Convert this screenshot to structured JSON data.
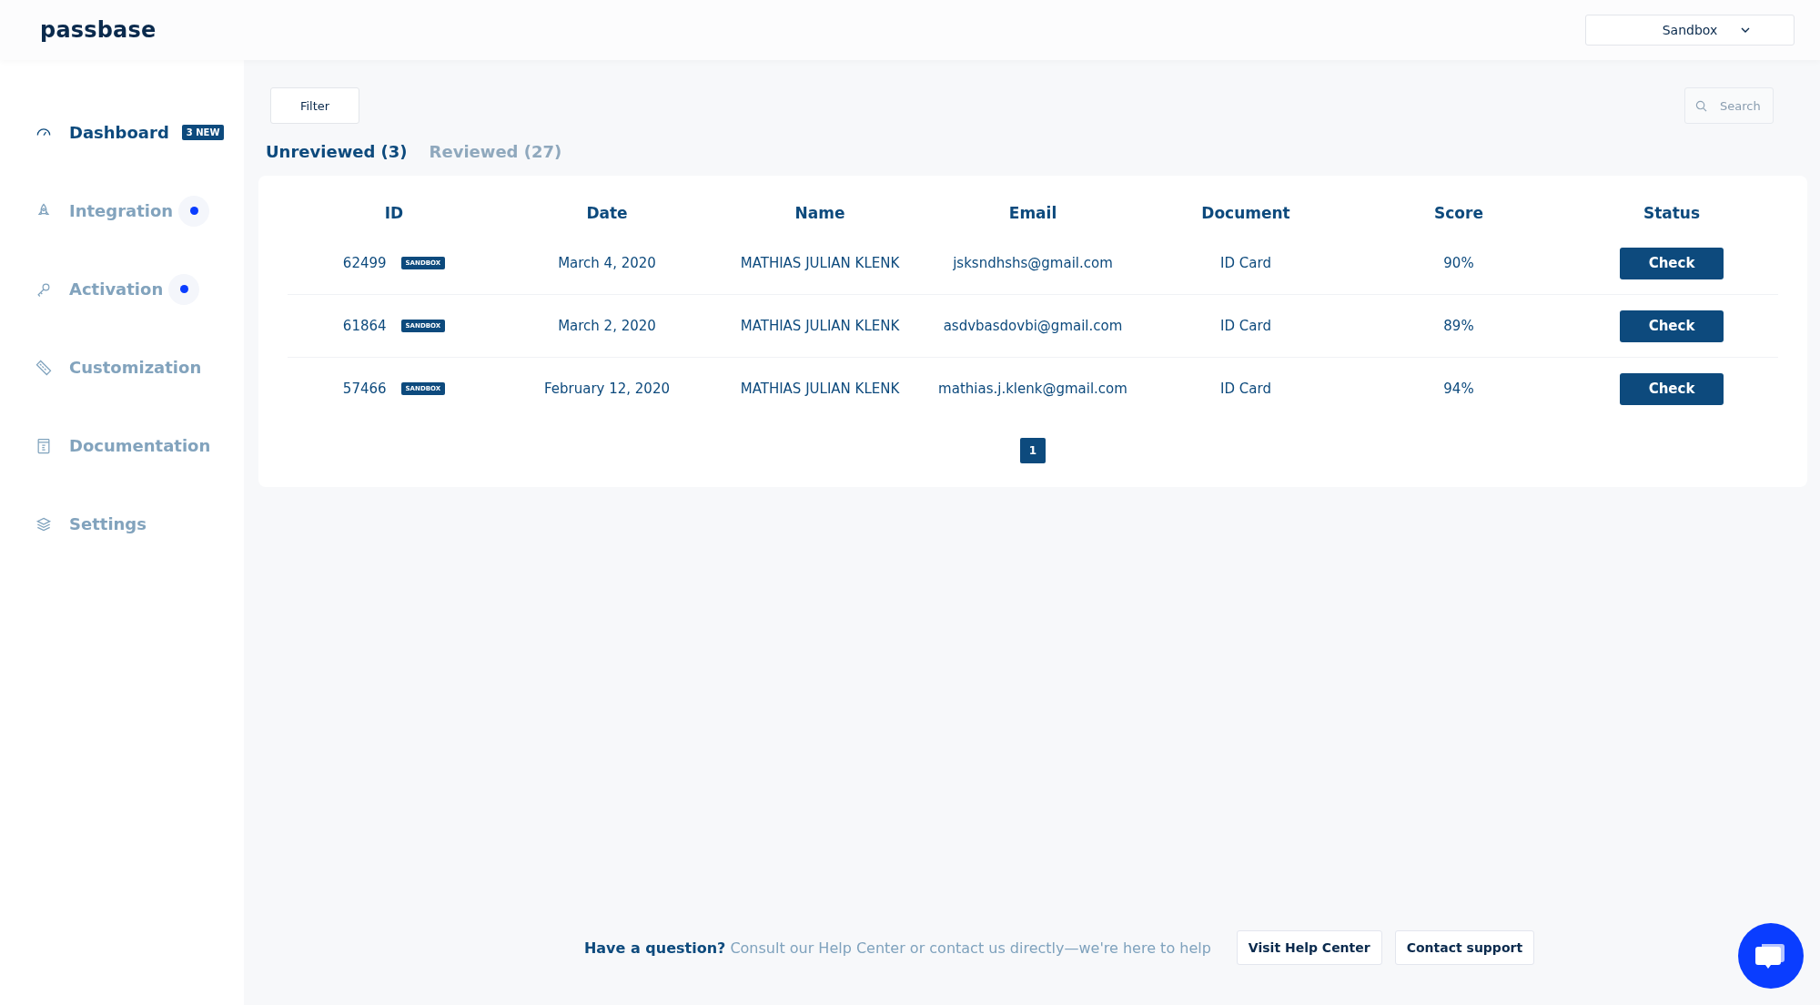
{
  "header": {
    "logo": "passbase",
    "environment": "Sandbox"
  },
  "sidebar": {
    "items": [
      {
        "label": "Dashboard",
        "selected": true,
        "badge": "3 NEW",
        "dot": false
      },
      {
        "label": "Integration",
        "selected": false,
        "dot": true
      },
      {
        "label": "Activation",
        "selected": false,
        "dot": true
      },
      {
        "label": "Customization",
        "selected": false,
        "dot": false
      },
      {
        "label": "Documentation",
        "selected": false,
        "dot": false
      },
      {
        "label": "Settings",
        "selected": false,
        "dot": false
      }
    ]
  },
  "toolbar": {
    "filter": "Filter",
    "search_placeholder": "Search"
  },
  "tabs": [
    {
      "label": "Unreviewed (3)",
      "selected": true
    },
    {
      "label": "Reviewed (27)",
      "selected": false
    }
  ],
  "table": {
    "columns": [
      "ID",
      "Date",
      "Name",
      "Email",
      "Document",
      "Score",
      "Status"
    ],
    "rows": [
      {
        "id": "62499",
        "tag": "SANDBOX",
        "date": "March 4, 2020",
        "name": "MATHIAS JULIAN KLENK",
        "email": "jsksndhshs@gmail.com",
        "document": "ID Card",
        "score": "90%",
        "action": "Check"
      },
      {
        "id": "61864",
        "tag": "SANDBOX",
        "date": "March 2, 2020",
        "name": "MATHIAS JULIAN KLENK",
        "email": "asdvbasdovbi@gmail.com",
        "document": "ID Card",
        "score": "89%",
        "action": "Check"
      },
      {
        "id": "57466",
        "tag": "SANDBOX",
        "date": "February 12, 2020",
        "name": "MATHIAS JULIAN KLENK",
        "email": "mathias.j.klenk@gmail.com",
        "document": "ID Card",
        "score": "94%",
        "action": "Check"
      }
    ]
  },
  "pagination": [
    {
      "label": "1",
      "selected": true
    }
  ],
  "footer": {
    "text": "**Have a question?** Consult our Help Center or contact us directly—we're here to help",
    "buttons": [
      "Visit Help Center",
      "Contact support"
    ]
  }
}
